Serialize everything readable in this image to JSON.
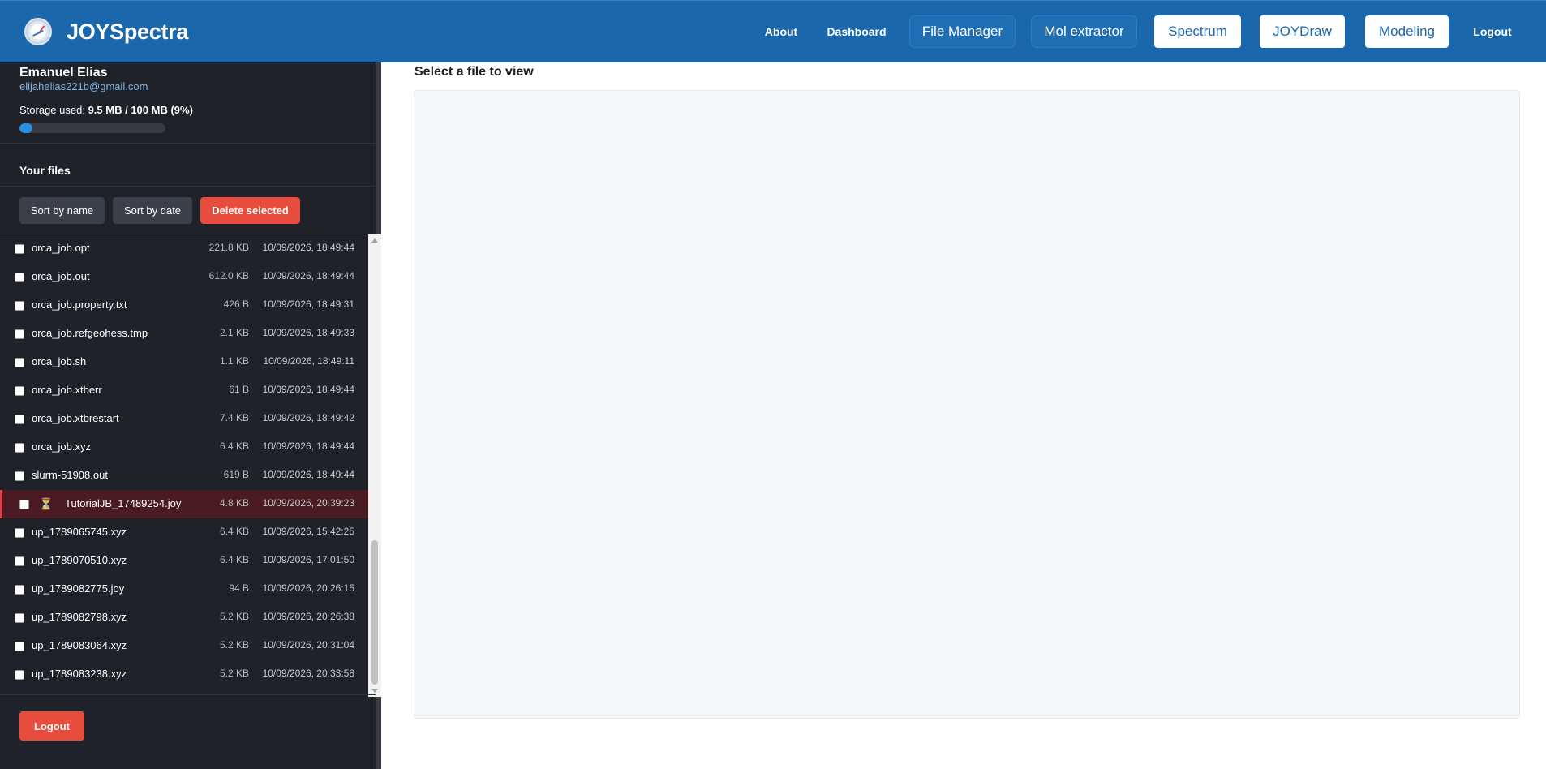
{
  "app": {
    "name": "JOYSpectra"
  },
  "nav": {
    "about": "About",
    "dashboard": "Dashboard",
    "file_manager": "File Manager",
    "mol_extractor": "Mol extractor",
    "spectrum": "Spectrum",
    "joydraw": "JOYDraw",
    "modeling": "Modeling",
    "logout": "Logout"
  },
  "user": {
    "name": "Emanuel Elias",
    "email": "elijahelias221b@gmail.com",
    "storage_label": "Storage used:",
    "storage_value": "9.5 MB / 100 MB (9%)",
    "storage_fraction": 0.09
  },
  "files_section": {
    "title": "Your files",
    "sort_by_name": "Sort by name",
    "sort_by_date": "Sort by date",
    "delete_selected": "Delete selected"
  },
  "files": [
    {
      "name": "orca_job.opt",
      "size": "221.8 KB",
      "date": "10/09/2026, 18:49:44"
    },
    {
      "name": "orca_job.out",
      "size": "612.0 KB",
      "date": "10/09/2026, 18:49:44"
    },
    {
      "name": "orca_job.property.txt",
      "size": "426 B",
      "date": "10/09/2026, 18:49:31"
    },
    {
      "name": "orca_job.refgeohess.tmp",
      "size": "2.1 KB",
      "date": "10/09/2026, 18:49:33"
    },
    {
      "name": "orca_job.sh",
      "size": "1.1 KB",
      "date": "10/09/2026, 18:49:11"
    },
    {
      "name": "orca_job.xtberr",
      "size": "61 B",
      "date": "10/09/2026, 18:49:44"
    },
    {
      "name": "orca_job.xtbrestart",
      "size": "7.4 KB",
      "date": "10/09/2026, 18:49:42"
    },
    {
      "name": "orca_job.xyz",
      "size": "6.4 KB",
      "date": "10/09/2026, 18:49:44"
    },
    {
      "name": "slurm-51908.out",
      "size": "619 B",
      "date": "10/09/2026, 18:49:44"
    },
    {
      "name": "TutorialJB_17489254.joy",
      "size": "4.8 KB",
      "date": "10/09/2026, 20:39:23",
      "pending": true,
      "icon": "hourglass-icon",
      "pending_glyph": "⏳"
    },
    {
      "name": "up_1789065745.xyz",
      "size": "6.4 KB",
      "date": "10/09/2026, 15:42:25"
    },
    {
      "name": "up_1789070510.xyz",
      "size": "6.4 KB",
      "date": "10/09/2026, 17:01:50"
    },
    {
      "name": "up_1789082775.joy",
      "size": "94 B",
      "date": "10/09/2026, 20:26:15"
    },
    {
      "name": "up_1789082798.xyz",
      "size": "5.2 KB",
      "date": "10/09/2026, 20:26:38"
    },
    {
      "name": "up_1789083064.xyz",
      "size": "5.2 KB",
      "date": "10/09/2026, 20:31:04"
    },
    {
      "name": "up_1789083238.xyz",
      "size": "5.2 KB",
      "date": "10/09/2026, 20:33:58"
    }
  ],
  "sidebar_footer": {
    "logout": "Logout"
  },
  "viewer": {
    "title": "Select a file to view"
  },
  "colors": {
    "header_bg": "#1b67ab",
    "sidebar_bg": "#1f2229",
    "danger": "#e74c3c",
    "storage_bar": "#2b8fe0",
    "link": "#7fb5e6"
  }
}
